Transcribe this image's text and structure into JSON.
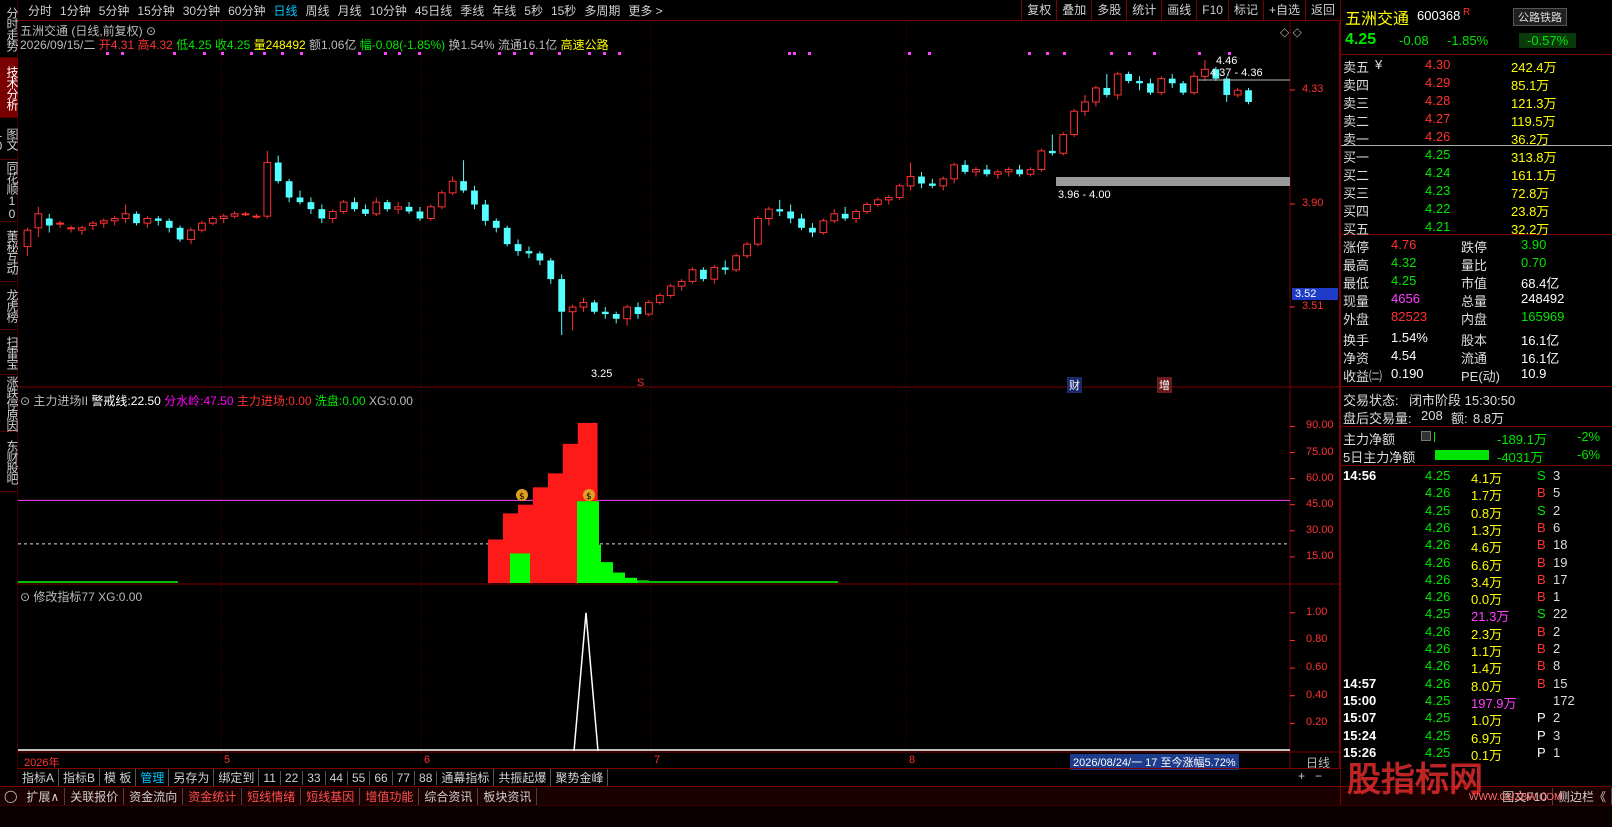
{
  "left_tabs": [
    "分时走势",
    "技术分析",
    "图文10",
    "同花顺10",
    "董秘互动",
    "龙虎榜",
    "扫雷宝",
    "涨跌停原因",
    "东财股吧"
  ],
  "left_active": 1,
  "periods": [
    "分时",
    "1分钟",
    "5分钟",
    "15分钟",
    "30分钟",
    "60分钟",
    "日线",
    "周线",
    "月线",
    "10分钟",
    "45日线",
    "季线",
    "年线",
    "5秒",
    "15秒",
    "多周期",
    "更多 >"
  ],
  "period_active": 6,
  "toolbar": [
    "复权",
    "叠加",
    "多股",
    "统计",
    "画线",
    "F10",
    "标记",
    "+自选",
    "返回"
  ],
  "main": {
    "title": "五洲交通 (日线,前复权)",
    "date": "2026/09/15/二",
    "open_label": "开",
    "open": "4.31",
    "high_label": "高",
    "high": "4.32",
    "low_label": "低",
    "low": "4.25",
    "close_label": "收",
    "close": "4.25",
    "vol_label": "量",
    "vol": "248492",
    "amt_label": "额",
    "amt": "1.06亿",
    "chg_label": "幅",
    "chg": "-0.08(-1.85%)",
    "turn_label": "换",
    "turn": "1.54%",
    "float_label": "流通",
    "float": "16.1亿",
    "sector": "高速公路",
    "ann_high": "4.46",
    "ann_range1": "4.37 - 4.36",
    "ann_range2": "3.96 - 4.00",
    "ann_low": "3.25",
    "marker_s": "S",
    "marker_cai": "财",
    "marker_zeng": "增",
    "yaxis": [
      "4.33",
      "3.90",
      "3.51"
    ],
    "cur_price_tag": "3.52"
  },
  "ind1": {
    "name": "主力进场II",
    "warn_label": "警戒线:",
    "warn": "22.50",
    "water_label": "分水岭:",
    "water": "47.50",
    "main_label": "主力进场:",
    "main": "0.00",
    "wash_label": "洗盘:",
    "wash": "0.00",
    "xg_label": "XG:",
    "xg": "0.00",
    "yaxis": [
      "90.00",
      "75.00",
      "60.00",
      "45.00",
      "30.00",
      "15.00"
    ]
  },
  "ind2": {
    "name": "修改指标77",
    "xg_label": "XG:",
    "xg": "0.00",
    "yaxis": [
      "1.00",
      "0.80",
      "0.60",
      "0.40",
      "0.20"
    ]
  },
  "xaxis": {
    "labels": [
      "2026年",
      "5",
      "6",
      "7",
      "8"
    ],
    "period": "日线",
    "range": "2026/08/24/一 17 至今涨幅5.72%"
  },
  "bottom_tabs": [
    "指标A",
    "指标B",
    "模 板",
    "管理",
    "另存为",
    "绑定到",
    "11",
    "22",
    "33",
    "44",
    "55",
    "66",
    "77",
    "88",
    "通幕指标",
    "共振起爆",
    "聚势金峰"
  ],
  "bottom_active": 3,
  "status": [
    "扩展∧",
    "关联报价",
    "资金流向",
    "资金统计",
    "短线情绪",
    "短线基因",
    "增值功能",
    "综合资讯",
    "板块资讯"
  ],
  "status_right": [
    "图文F10",
    "侧边栏《"
  ],
  "quote": {
    "name": "五洲交通",
    "code": "600368",
    "r_mark": "R",
    "sector_btn": "公路铁路",
    "price": "4.25",
    "chg": "-0.08",
    "pct": "-1.85%",
    "sector_pct": "-0.57%",
    "asks": [
      {
        "label": "卖五",
        "flag": "¥",
        "price": "4.30",
        "vol": "242.4万"
      },
      {
        "label": "卖四",
        "flag": "",
        "price": "4.29",
        "vol": "85.1万"
      },
      {
        "label": "卖三",
        "flag": "",
        "price": "4.28",
        "vol": "121.3万"
      },
      {
        "label": "卖二",
        "flag": "",
        "price": "4.27",
        "vol": "119.5万"
      },
      {
        "label": "卖一",
        "flag": "",
        "price": "4.26",
        "vol": "36.2万"
      }
    ],
    "bids": [
      {
        "label": "买一",
        "price": "4.25",
        "vol": "313.8万"
      },
      {
        "label": "买二",
        "price": "4.24",
        "vol": "161.1万"
      },
      {
        "label": "买三",
        "price": "4.23",
        "vol": "72.8万"
      },
      {
        "label": "买四",
        "price": "4.22",
        "vol": "23.8万"
      },
      {
        "label": "买五",
        "price": "4.21",
        "vol": "32.2万"
      }
    ],
    "stats": [
      {
        "l1": "涨停",
        "v1": "4.76",
        "c1": "red",
        "l2": "跌停",
        "v2": "3.90",
        "c2": "green"
      },
      {
        "l1": "最高",
        "v1": "4.32",
        "c1": "green",
        "l2": "量比",
        "v2": "0.70",
        "c2": "green"
      },
      {
        "l1": "最低",
        "v1": "4.25",
        "c1": "green",
        "l2": "市值",
        "v2": "68.4亿",
        "c2": "white"
      },
      {
        "l1": "现量",
        "v1": "4656",
        "c1": "magenta",
        "l2": "总量",
        "v2": "248492",
        "c2": "white"
      },
      {
        "l1": "外盘",
        "v1": "82523",
        "c1": "red",
        "l2": "内盘",
        "v2": "165969",
        "c2": "green"
      },
      {
        "l1": "换手",
        "v1": "1.54%",
        "c1": "white",
        "l2": "股本",
        "v2": "16.1亿",
        "c2": "white"
      },
      {
        "l1": "净资",
        "v1": "4.54",
        "c1": "white",
        "l2": "流通",
        "v2": "16.1亿",
        "c2": "white"
      },
      {
        "l1": "收益㈡",
        "v1": "0.190",
        "c1": "white",
        "l2": "PE(动)",
        "v2": "10.9",
        "c2": "white"
      }
    ],
    "trade_state_label": "交易状态:",
    "trade_state": "闭市阶段 15:30:50",
    "after_vol_label": "盘后交易量:",
    "after_vol": "208",
    "after_amt_label": "额:",
    "after_amt": "8.8万",
    "net_label": "主力净额",
    "net": "-189.1万",
    "net_pct": "-2%",
    "net5_label": "5日主力净额",
    "net5": "-4031万",
    "net5_pct": "-6%",
    "ticks": [
      {
        "t": "14:56",
        "p": "4.25",
        "v": "4.1万",
        "bs": "S",
        "n": "3"
      },
      {
        "t": "",
        "p": "4.26",
        "v": "1.7万",
        "bs": "B",
        "n": "5"
      },
      {
        "t": "",
        "p": "4.25",
        "v": "0.8万",
        "bs": "S",
        "n": "2"
      },
      {
        "t": "",
        "p": "4.26",
        "v": "1.3万",
        "bs": "B",
        "n": "6"
      },
      {
        "t": "",
        "p": "4.26",
        "v": "4.6万",
        "bs": "B",
        "n": "18"
      },
      {
        "t": "",
        "p": "4.26",
        "v": "6.6万",
        "bs": "B",
        "n": "19"
      },
      {
        "t": "",
        "p": "4.26",
        "v": "3.4万",
        "bs": "B",
        "n": "17"
      },
      {
        "t": "",
        "p": "4.26",
        "v": "0.0万",
        "bs": "B",
        "n": "1"
      },
      {
        "t": "",
        "p": "4.25",
        "v": "21.3万",
        "bs": "S",
        "n": "22"
      },
      {
        "t": "",
        "p": "4.26",
        "v": "2.3万",
        "bs": "B",
        "n": "2"
      },
      {
        "t": "",
        "p": "4.26",
        "v": "1.1万",
        "bs": "B",
        "n": "2"
      },
      {
        "t": "",
        "p": "4.26",
        "v": "1.4万",
        "bs": "B",
        "n": "8"
      },
      {
        "t": "14:57",
        "p": "4.26",
        "v": "8.0万",
        "bs": "B",
        "n": "15"
      },
      {
        "t": "15:00",
        "p": "4.25",
        "v": "197.9万",
        "bs": "",
        "n": "172"
      },
      {
        "t": "15:07",
        "p": "4.25",
        "v": "1.0万",
        "bs": "P",
        "n": "2"
      },
      {
        "t": "15:24",
        "p": "4.25",
        "v": "6.9万",
        "bs": "P",
        "n": "3"
      },
      {
        "t": "15:26",
        "p": "4.25",
        "v": "0.1万",
        "bs": "P",
        "n": "1"
      }
    ]
  },
  "watermark": "股指标网",
  "watermark_url": "WWW.GUZBW.COM",
  "chart_data": {
    "type": "candlestick",
    "yrange": [
      3.1,
      4.55
    ],
    "candles": [
      [
        3.66,
        3.74,
        3.62,
        3.73
      ],
      [
        3.74,
        3.83,
        3.7,
        3.8
      ],
      [
        3.78,
        3.8,
        3.72,
        3.75
      ],
      [
        3.76,
        3.77,
        3.74,
        3.76
      ],
      [
        3.74,
        3.75,
        3.72,
        3.74
      ],
      [
        3.73,
        3.75,
        3.71,
        3.74
      ],
      [
        3.75,
        3.77,
        3.73,
        3.76
      ],
      [
        3.76,
        3.78,
        3.74,
        3.77
      ],
      [
        3.77,
        3.79,
        3.75,
        3.78
      ],
      [
        3.78,
        3.84,
        3.76,
        3.8
      ],
      [
        3.8,
        3.81,
        3.75,
        3.76
      ],
      [
        3.76,
        3.79,
        3.74,
        3.78
      ],
      [
        3.78,
        3.79,
        3.75,
        3.77
      ],
      [
        3.77,
        3.78,
        3.72,
        3.74
      ],
      [
        3.74,
        3.75,
        3.68,
        3.69
      ],
      [
        3.69,
        3.74,
        3.67,
        3.73
      ],
      [
        3.73,
        3.77,
        3.72,
        3.76
      ],
      [
        3.76,
        3.79,
        3.75,
        3.78
      ],
      [
        3.78,
        3.8,
        3.76,
        3.79
      ],
      [
        3.79,
        3.81,
        3.78,
        3.8
      ],
      [
        3.8,
        3.81,
        3.79,
        3.8
      ],
      [
        3.79,
        3.8,
        3.78,
        3.79
      ],
      [
        3.79,
        4.07,
        3.78,
        4.02
      ],
      [
        4.02,
        4.05,
        3.93,
        3.94
      ],
      [
        3.94,
        3.95,
        3.85,
        3.87
      ],
      [
        3.87,
        3.9,
        3.84,
        3.85
      ],
      [
        3.85,
        3.87,
        3.8,
        3.82
      ],
      [
        3.82,
        3.84,
        3.76,
        3.78
      ],
      [
        3.78,
        3.82,
        3.76,
        3.81
      ],
      [
        3.81,
        3.86,
        3.8,
        3.85
      ],
      [
        3.85,
        3.87,
        3.81,
        3.82
      ],
      [
        3.82,
        3.84,
        3.79,
        3.8
      ],
      [
        3.8,
        3.87,
        3.79,
        3.85
      ],
      [
        3.85,
        3.86,
        3.81,
        3.82
      ],
      [
        3.82,
        3.85,
        3.8,
        3.83
      ],
      [
        3.83,
        3.85,
        3.8,
        3.81
      ],
      [
        3.81,
        3.83,
        3.77,
        3.78
      ],
      [
        3.78,
        3.84,
        3.77,
        3.83
      ],
      [
        3.83,
        3.9,
        3.82,
        3.89
      ],
      [
        3.89,
        3.96,
        3.88,
        3.94
      ],
      [
        3.94,
        4.03,
        3.89,
        3.9
      ],
      [
        3.9,
        3.92,
        3.82,
        3.84
      ],
      [
        3.84,
        3.86,
        3.75,
        3.77
      ],
      [
        3.77,
        3.78,
        3.72,
        3.74
      ],
      [
        3.74,
        3.75,
        3.66,
        3.67
      ],
      [
        3.67,
        3.69,
        3.62,
        3.64
      ],
      [
        3.64,
        3.66,
        3.61,
        3.63
      ],
      [
        3.63,
        3.64,
        3.58,
        3.6
      ],
      [
        3.6,
        3.61,
        3.5,
        3.52
      ],
      [
        3.52,
        3.54,
        3.28,
        3.38
      ],
      [
        3.38,
        3.41,
        3.3,
        3.4
      ],
      [
        3.4,
        3.44,
        3.38,
        3.42
      ],
      [
        3.42,
        3.43,
        3.37,
        3.38
      ],
      [
        3.38,
        3.4,
        3.35,
        3.37
      ],
      [
        3.37,
        3.38,
        3.33,
        3.35
      ],
      [
        3.35,
        3.41,
        3.32,
        3.4
      ],
      [
        3.4,
        3.42,
        3.35,
        3.37
      ],
      [
        3.37,
        3.43,
        3.36,
        3.42
      ],
      [
        3.42,
        3.46,
        3.41,
        3.45
      ],
      [
        3.45,
        3.5,
        3.44,
        3.49
      ],
      [
        3.49,
        3.52,
        3.47,
        3.51
      ],
      [
        3.51,
        3.57,
        3.5,
        3.56
      ],
      [
        3.56,
        3.57,
        3.51,
        3.52
      ],
      [
        3.52,
        3.58,
        3.5,
        3.57
      ],
      [
        3.57,
        3.6,
        3.54,
        3.56
      ],
      [
        3.56,
        3.63,
        3.55,
        3.62
      ],
      [
        3.62,
        3.68,
        3.61,
        3.67
      ],
      [
        3.67,
        3.79,
        3.66,
        3.78
      ],
      [
        3.78,
        3.83,
        3.75,
        3.82
      ],
      [
        3.82,
        3.86,
        3.79,
        3.81
      ],
      [
        3.81,
        3.84,
        3.76,
        3.78
      ],
      [
        3.78,
        3.8,
        3.73,
        3.74
      ],
      [
        3.74,
        3.76,
        3.7,
        3.72
      ],
      [
        3.72,
        3.78,
        3.71,
        3.77
      ],
      [
        3.77,
        3.82,
        3.76,
        3.8
      ],
      [
        3.8,
        3.83,
        3.77,
        3.78
      ],
      [
        3.78,
        3.82,
        3.76,
        3.81
      ],
      [
        3.81,
        3.85,
        3.8,
        3.84
      ],
      [
        3.84,
        3.87,
        3.83,
        3.86
      ],
      [
        3.86,
        3.88,
        3.84,
        3.87
      ],
      [
        3.87,
        3.93,
        3.86,
        3.92
      ],
      [
        3.92,
        4.02,
        3.9,
        3.96
      ],
      [
        3.96,
        3.98,
        3.91,
        3.93
      ],
      [
        3.93,
        3.95,
        3.91,
        3.92
      ],
      [
        3.92,
        3.96,
        3.9,
        3.95
      ],
      [
        3.95,
        4.02,
        3.93,
        4.01
      ],
      [
        4.01,
        4.03,
        3.97,
        3.98
      ],
      [
        3.98,
        4.0,
        3.96,
        3.99
      ],
      [
        3.99,
        4.01,
        3.96,
        3.97
      ],
      [
        3.97,
        3.99,
        3.95,
        3.98
      ],
      [
        3.98,
        4.0,
        3.96,
        3.99
      ],
      [
        3.99,
        4.01,
        3.96,
        3.97
      ],
      [
        3.97,
        4.0,
        3.96,
        3.99
      ],
      [
        3.99,
        4.08,
        3.98,
        4.07
      ],
      [
        4.07,
        4.14,
        4.05,
        4.06
      ],
      [
        4.06,
        4.15,
        4.05,
        4.14
      ],
      [
        4.14,
        4.25,
        4.13,
        4.24
      ],
      [
        4.24,
        4.31,
        4.22,
        4.28
      ],
      [
        4.28,
        4.35,
        4.26,
        4.34
      ],
      [
        4.34,
        4.4,
        4.3,
        4.31
      ],
      [
        4.31,
        4.41,
        4.29,
        4.4
      ],
      [
        4.4,
        4.41,
        4.36,
        4.37
      ],
      [
        4.37,
        4.39,
        4.33,
        4.36
      ],
      [
        4.36,
        4.38,
        4.31,
        4.32
      ],
      [
        4.32,
        4.39,
        4.31,
        4.38
      ],
      [
        4.38,
        4.4,
        4.34,
        4.36
      ],
      [
        4.36,
        4.37,
        4.31,
        4.32
      ],
      [
        4.32,
        4.41,
        4.31,
        4.39
      ],
      [
        4.39,
        4.46,
        4.37,
        4.42
      ],
      [
        4.42,
        4.43,
        4.37,
        4.38
      ],
      [
        4.38,
        4.39,
        4.28,
        4.31
      ],
      [
        4.31,
        4.34,
        4.3,
        4.33
      ],
      [
        4.33,
        4.34,
        4.27,
        4.28
      ]
    ],
    "ind1": {
      "lines": {
        "warn": 22.5,
        "water": 47.5
      },
      "yrange": [
        0,
        100
      ],
      "red_bars": [
        {
          "i": 49,
          "v": 25
        },
        {
          "i": 50,
          "v": 40
        },
        {
          "i": 51,
          "v": 45
        },
        {
          "i": 52,
          "v": 55
        },
        {
          "i": 53,
          "v": 63
        },
        {
          "i": 54,
          "v": 80
        },
        {
          "i": 55,
          "v": 92
        }
      ],
      "green_bars": [
        {
          "i": 51,
          "v": 17
        },
        {
          "i": 56,
          "v": 47
        },
        {
          "i": 57,
          "v": 22
        },
        {
          "i": 58,
          "v": 12
        },
        {
          "i": 59,
          "v": 6
        },
        {
          "i": 60,
          "v": 3
        },
        {
          "i": 61,
          "v": 1.5
        }
      ]
    },
    "ind2": {
      "yrange": [
        0,
        1.1
      ],
      "spike_index": 56
    }
  }
}
